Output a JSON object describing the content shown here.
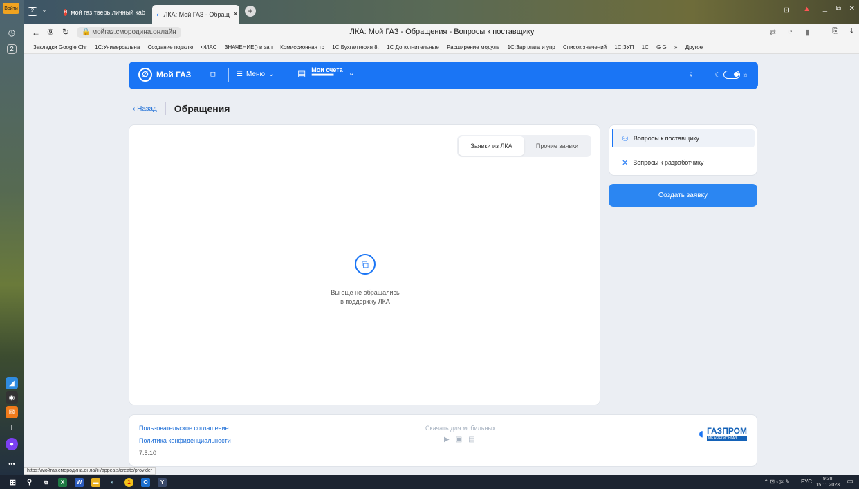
{
  "browser": {
    "tabs": [
      {
        "label": "мой газ тверь личный каб"
      },
      {
        "label": "ЛКА: Мой ГАЗ - Обращ"
      }
    ],
    "tab_count": "2",
    "url": "мойгаз.смородина.онлайн",
    "page_title": "ЛКА: Мой ГАЗ - Обращения - Вопросы к поставщику",
    "status_url": "https://мойгаз.смородина.онлайн/appeals/create/provider",
    "signin_badge": "Войти",
    "bookmarks": [
      "Закладки Google Chr",
      "1С:Универсальна",
      "Создание подклю",
      "ФИАС",
      "ЗНАЧЕНИЕ() в зап",
      "Комиссионная то",
      "1С:Бухгалтерия 8.",
      "1С Дополнительные",
      "Расширение модуле",
      "1С:Зарплата и упр",
      "Список значений",
      "1С:ЗУП",
      "1С",
      "G G",
      "»",
      "Другое"
    ]
  },
  "app": {
    "brand": "Мой ГАЗ",
    "menu_label": "Меню",
    "accounts_label": "Мои счета",
    "accounts_value": "■■■■■■■■■■■■",
    "back_label": "Назад",
    "page_title": "Обращения",
    "tabs": [
      "Заявки из ЛКА",
      "Прочие заявки"
    ],
    "empty_line1": "Вы еще не обращались",
    "empty_line2": "в поддержку ЛКА",
    "side_items": [
      "Вопросы к поставщику",
      "Вопросы к разработчику"
    ],
    "create_button": "Создать заявку",
    "footer": {
      "agreement": "Пользовательское соглашение",
      "privacy": "Политика конфиденциальности",
      "version": "7.5.10",
      "download": "Скачать для мобильных:",
      "logo_top": "ГАЗПРОМ",
      "logo_bottom": "МЕЖРЕГИОНГАЗ"
    },
    "accent": "#1a75f5"
  },
  "taskbar": {
    "lang": "РУС",
    "time": "9:38",
    "date": "15.11.2023"
  }
}
